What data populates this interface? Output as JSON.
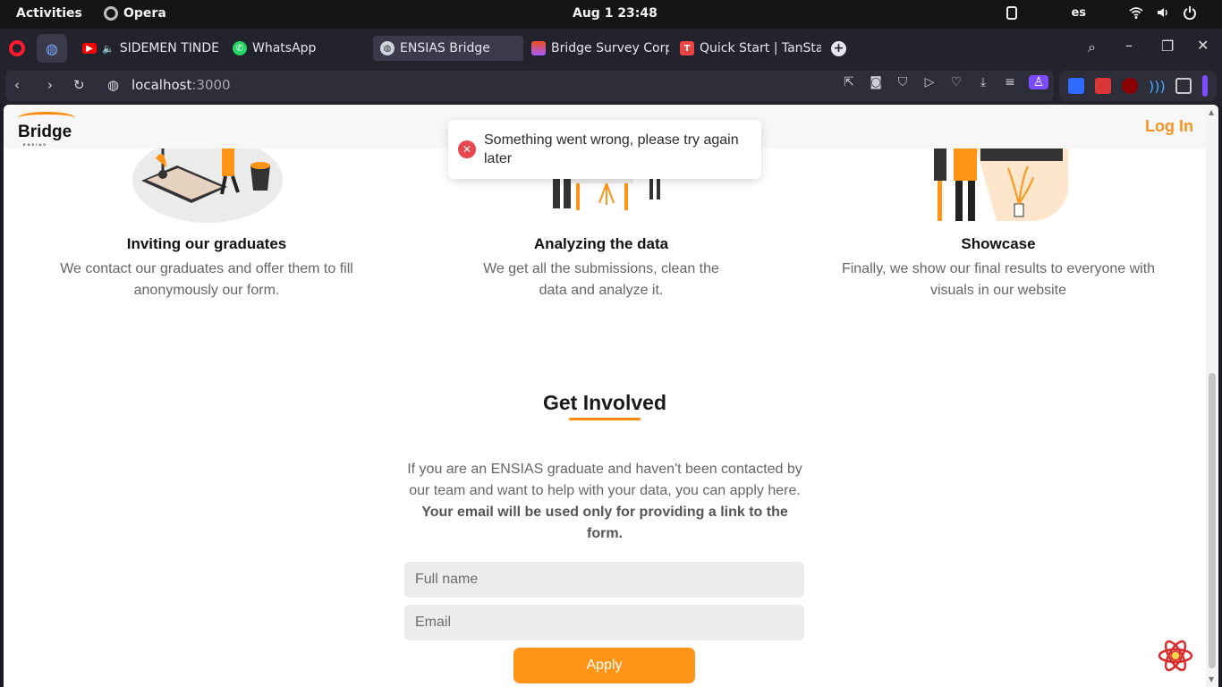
{
  "system": {
    "activities": "Activities",
    "app_name": "Opera",
    "clock": "Aug 1  23:48",
    "keyboard_layout": "es"
  },
  "tabs": [
    {
      "title": "SIDEMEN TINDER",
      "icon": "youtube-icon",
      "color": "#ff0000"
    },
    {
      "title": "WhatsApp",
      "icon": "whatsapp-icon",
      "color": "#25d366"
    },
    {
      "title": "ENSIAS Bridge",
      "icon": "globe-icon",
      "color": "#8aa0ff"
    },
    {
      "title": "Bridge Survey Corps",
      "icon": "figma-icon",
      "color": "#f24e1e"
    },
    {
      "title": "Quick Start | TanStac",
      "icon": "tanstack-icon",
      "color": "#ef4444"
    }
  ],
  "address": {
    "host": "localhost",
    "port": ":3000"
  },
  "site": {
    "logo_text": "Bridge",
    "logo_sub": "ENSIAS",
    "login_label": "Log In"
  },
  "steps": [
    {
      "title": "Inviting our graduates",
      "desc": "We contact our graduates and offer them to fill anonymously our form."
    },
    {
      "title": "Analyzing the data",
      "desc": "We get all the submissions, clean the data and analyze it."
    },
    {
      "title": "Showcase",
      "desc": "Finally, we show our final results to everyone with visuals in our website"
    }
  ],
  "involved": {
    "title": "Get Involved",
    "intro": "If you are an ENSIAS graduate and haven't been contacted by our team and want to help with your data, you can apply here.",
    "intro_bold": "Your email will be used only for providing a link to the form.",
    "name_placeholder": "Full name",
    "email_placeholder": "Email",
    "apply_label": "Apply"
  },
  "toast": {
    "message": "Something went wrong, please try again later",
    "type": "error"
  },
  "colors": {
    "accent": "#ff9416",
    "error": "#e5484d"
  }
}
